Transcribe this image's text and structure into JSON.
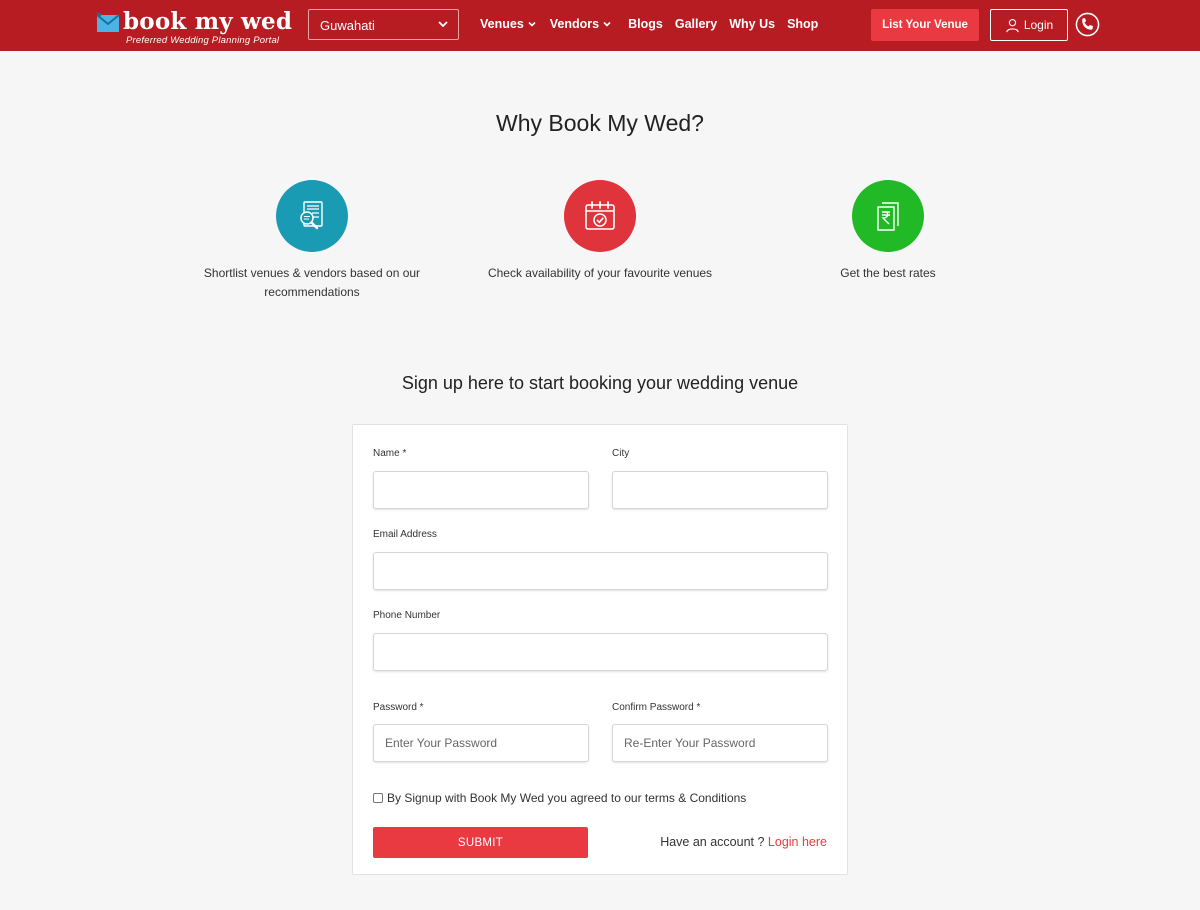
{
  "header": {
    "logo_text": "book my wed",
    "logo_tagline": "Preferred Wedding Planning Portal",
    "city": "Guwahati",
    "nav": [
      {
        "label": "Venues",
        "dropdown": true
      },
      {
        "label": "Vendors",
        "dropdown": true
      },
      {
        "label": "Blogs",
        "dropdown": false
      },
      {
        "label": "Gallery",
        "dropdown": false
      },
      {
        "label": "Why Us",
        "dropdown": false
      },
      {
        "label": "Shop",
        "dropdown": false
      }
    ],
    "list_venue_label": "List Your Venue",
    "login_label": "Login",
    "icons": {
      "user": "user-icon",
      "phone": "phone-icon",
      "chevron": "chevron-down-icon"
    }
  },
  "why": {
    "title": "Why Book My Wed?",
    "features": [
      {
        "text": "Shortlist venues & vendors based on our recommendations",
        "color": "#1a9bb4",
        "icon": "document-search-icon"
      },
      {
        "text": "Check availability of your favourite venues",
        "color": "#e0343c",
        "icon": "calendar-check-icon"
      },
      {
        "text": "Get the best rates",
        "color": "#22b926",
        "icon": "rupee-document-icon"
      }
    ]
  },
  "signup": {
    "title": "Sign up here to start booking your wedding venue",
    "name_label": "Name *",
    "city_label": "City",
    "email_label": "Email Address",
    "phone_label": "Phone Number",
    "password_label": "Password *",
    "password_placeholder": "Enter Your Password",
    "confirm_label": "Confirm Password *",
    "confirm_placeholder": "Re-Enter Your Password",
    "terms_text": "By Signup with Book My Wed you agreed to our terms & Conditions",
    "submit_label": "SUBMIT",
    "have_account_text": "Have an account ?",
    "login_link": "Login here"
  },
  "colors": {
    "brand": "#b71c23",
    "accent": "#e83a40"
  }
}
